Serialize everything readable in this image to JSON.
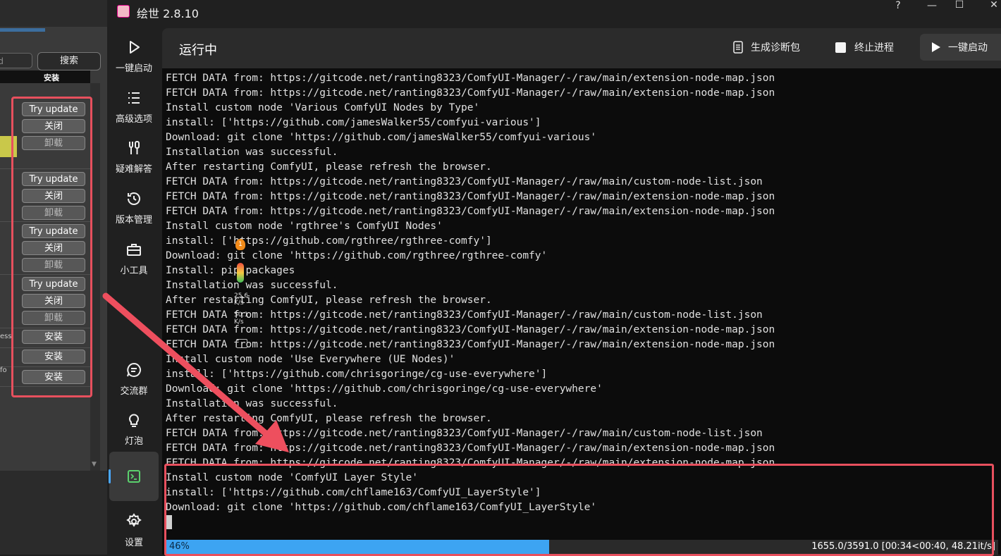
{
  "window": {
    "title": "绘世 2.8.10",
    "help": "?",
    "minimize": "—",
    "maximize": "☐",
    "close": "✕"
  },
  "background_app": {
    "search_placeholder": "d",
    "search_button": "搜索",
    "column_header": "安装",
    "buttons": [
      "Try update",
      "关闭",
      "卸载",
      "Try update",
      "关闭",
      "卸载",
      "Try update",
      "关闭",
      "卸载",
      "Try update",
      "关闭",
      "卸载",
      "安装",
      "安装",
      "安装"
    ],
    "cut_text": [
      "ess",
      "fo"
    ]
  },
  "sidebar": {
    "items": [
      {
        "label": "一键启动",
        "icon": "play-icon"
      },
      {
        "label": "高级选项",
        "icon": "list-icon"
      },
      {
        "label": "疑难解答",
        "icon": "tools-icon"
      },
      {
        "label": "版本管理",
        "icon": "history-icon"
      },
      {
        "label": "小工具",
        "icon": "toolbox-icon"
      },
      {
        "label": "交流群",
        "icon": "chat-icon"
      },
      {
        "label": "灯泡",
        "icon": "lightbulb-icon"
      },
      {
        "label": "",
        "icon": "console-icon",
        "active": true
      },
      {
        "label": "设置",
        "icon": "gear-icon"
      }
    ]
  },
  "content": {
    "heading": "运行中",
    "diagnostics_button": "生成诊断包",
    "terminate_label": "终止进程",
    "oneclick_button": "一键启动"
  },
  "terminal": {
    "lines": [
      "FETCH DATA from: https://gitcode.net/ranting8323/ComfyUI-Manager/-/raw/main/extension-node-map.json",
      "FETCH DATA from: https://gitcode.net/ranting8323/ComfyUI-Manager/-/raw/main/extension-node-map.json",
      "Install custom node 'Various ComfyUI Nodes by Type'",
      "install: ['https://github.com/jamesWalker55/comfyui-various']",
      "Download: git clone 'https://github.com/jamesWalker55/comfyui-various'",
      "Installation was successful.",
      "After restarting ComfyUI, please refresh the browser.",
      "FETCH DATA from: https://gitcode.net/ranting8323/ComfyUI-Manager/-/raw/main/custom-node-list.json",
      "FETCH DATA from: https://gitcode.net/ranting8323/ComfyUI-Manager/-/raw/main/extension-node-map.json",
      "FETCH DATA from: https://gitcode.net/ranting8323/ComfyUI-Manager/-/raw/main/extension-node-map.json",
      "Install custom node 'rgthree's ComfyUI Nodes'",
      "install: ['https://github.com/rgthree/rgthree-comfy']",
      "Download: git clone 'https://github.com/rgthree/rgthree-comfy'",
      "Install: pip packages",
      "Installation was successful.",
      "After restarting ComfyUI, please refresh the browser.",
      "FETCH DATA from: https://gitcode.net/ranting8323/ComfyUI-Manager/-/raw/main/custom-node-list.json",
      "FETCH DATA from: https://gitcode.net/ranting8323/ComfyUI-Manager/-/raw/main/extension-node-map.json",
      "FETCH DATA from: https://gitcode.net/ranting8323/ComfyUI-Manager/-/raw/main/extension-node-map.json",
      "Install custom node 'Use Everywhere (UE Nodes)'",
      "install: ['https://github.com/chrisgoringe/cg-use-everywhere']",
      "Download: git clone 'https://github.com/chrisgoringe/cg-use-everywhere'",
      "Installation was successful.",
      "After restarting ComfyUI, please refresh the browser.",
      "FETCH DATA from: https://gitcode.net/ranting8323/ComfyUI-Manager/-/raw/main/custom-node-list.json",
      "FETCH DATA from: https://gitcode.net/ranting8323/ComfyUI-Manager/-/raw/main/extension-node-map.json",
      "FETCH DATA from: https://gitcode.net/ranting8323/ComfyUI-Manager/-/raw/main/extension-node-map.json",
      "Install custom node 'ComfyUI Layer Style'",
      "install: ['https://github.com/chflame163/ComfyUI_LayerStyle']",
      "Download: git clone 'https://github.com/chflame163/ComfyUI_LayerStyle'"
    ],
    "progress": {
      "percent": 46,
      "label": "46%",
      "stats": "1655.0/3591.0 [00:34<00:40, 48.21it/s]"
    }
  },
  "overlay_widget": {
    "badge": "1",
    "upload": "25.6",
    "upload_unit": "K/s",
    "download": "50.1",
    "download_unit": "K/s"
  },
  "colors": {
    "accent": "#3da4f2",
    "highlight": "#e8505e",
    "terminal_bg": "#0c0c0c"
  }
}
